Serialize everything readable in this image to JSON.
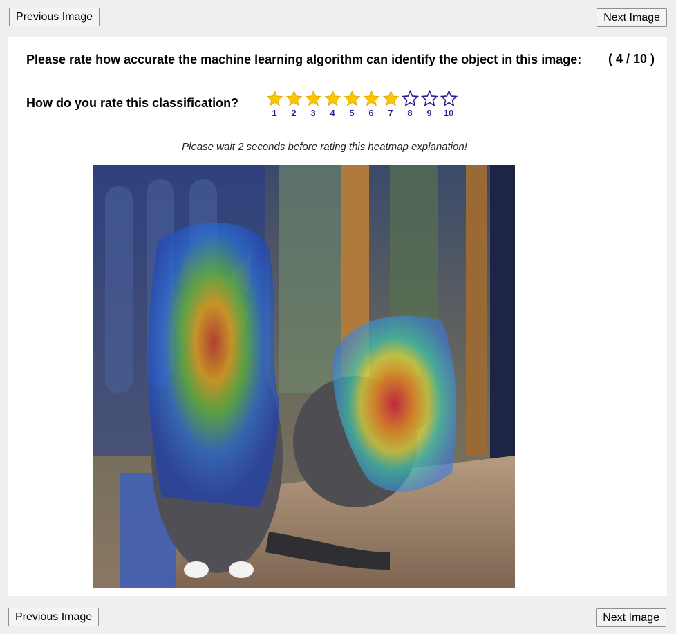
{
  "nav": {
    "prev_label": "Previous Image",
    "next_label": "Next Image"
  },
  "question": {
    "text": "Please rate how accurate the machine learning algorithm can identify the object in this image:",
    "progress": "( 4 / 10 )"
  },
  "rating": {
    "label": "How do you rate this classification?",
    "max": 10,
    "selected": 7,
    "numbers": [
      "1",
      "2",
      "3",
      "4",
      "5",
      "6",
      "7",
      "8",
      "9",
      "10"
    ],
    "filled_color": "#f9c600",
    "empty_color": "#2c1d8f",
    "number_color": "#2c1d8f"
  },
  "note": "Please wait 2 seconds before rating this heatmap explanation!",
  "image": {
    "subject": "two grey cats sitting on a wooden table with a heatmap overlay"
  }
}
